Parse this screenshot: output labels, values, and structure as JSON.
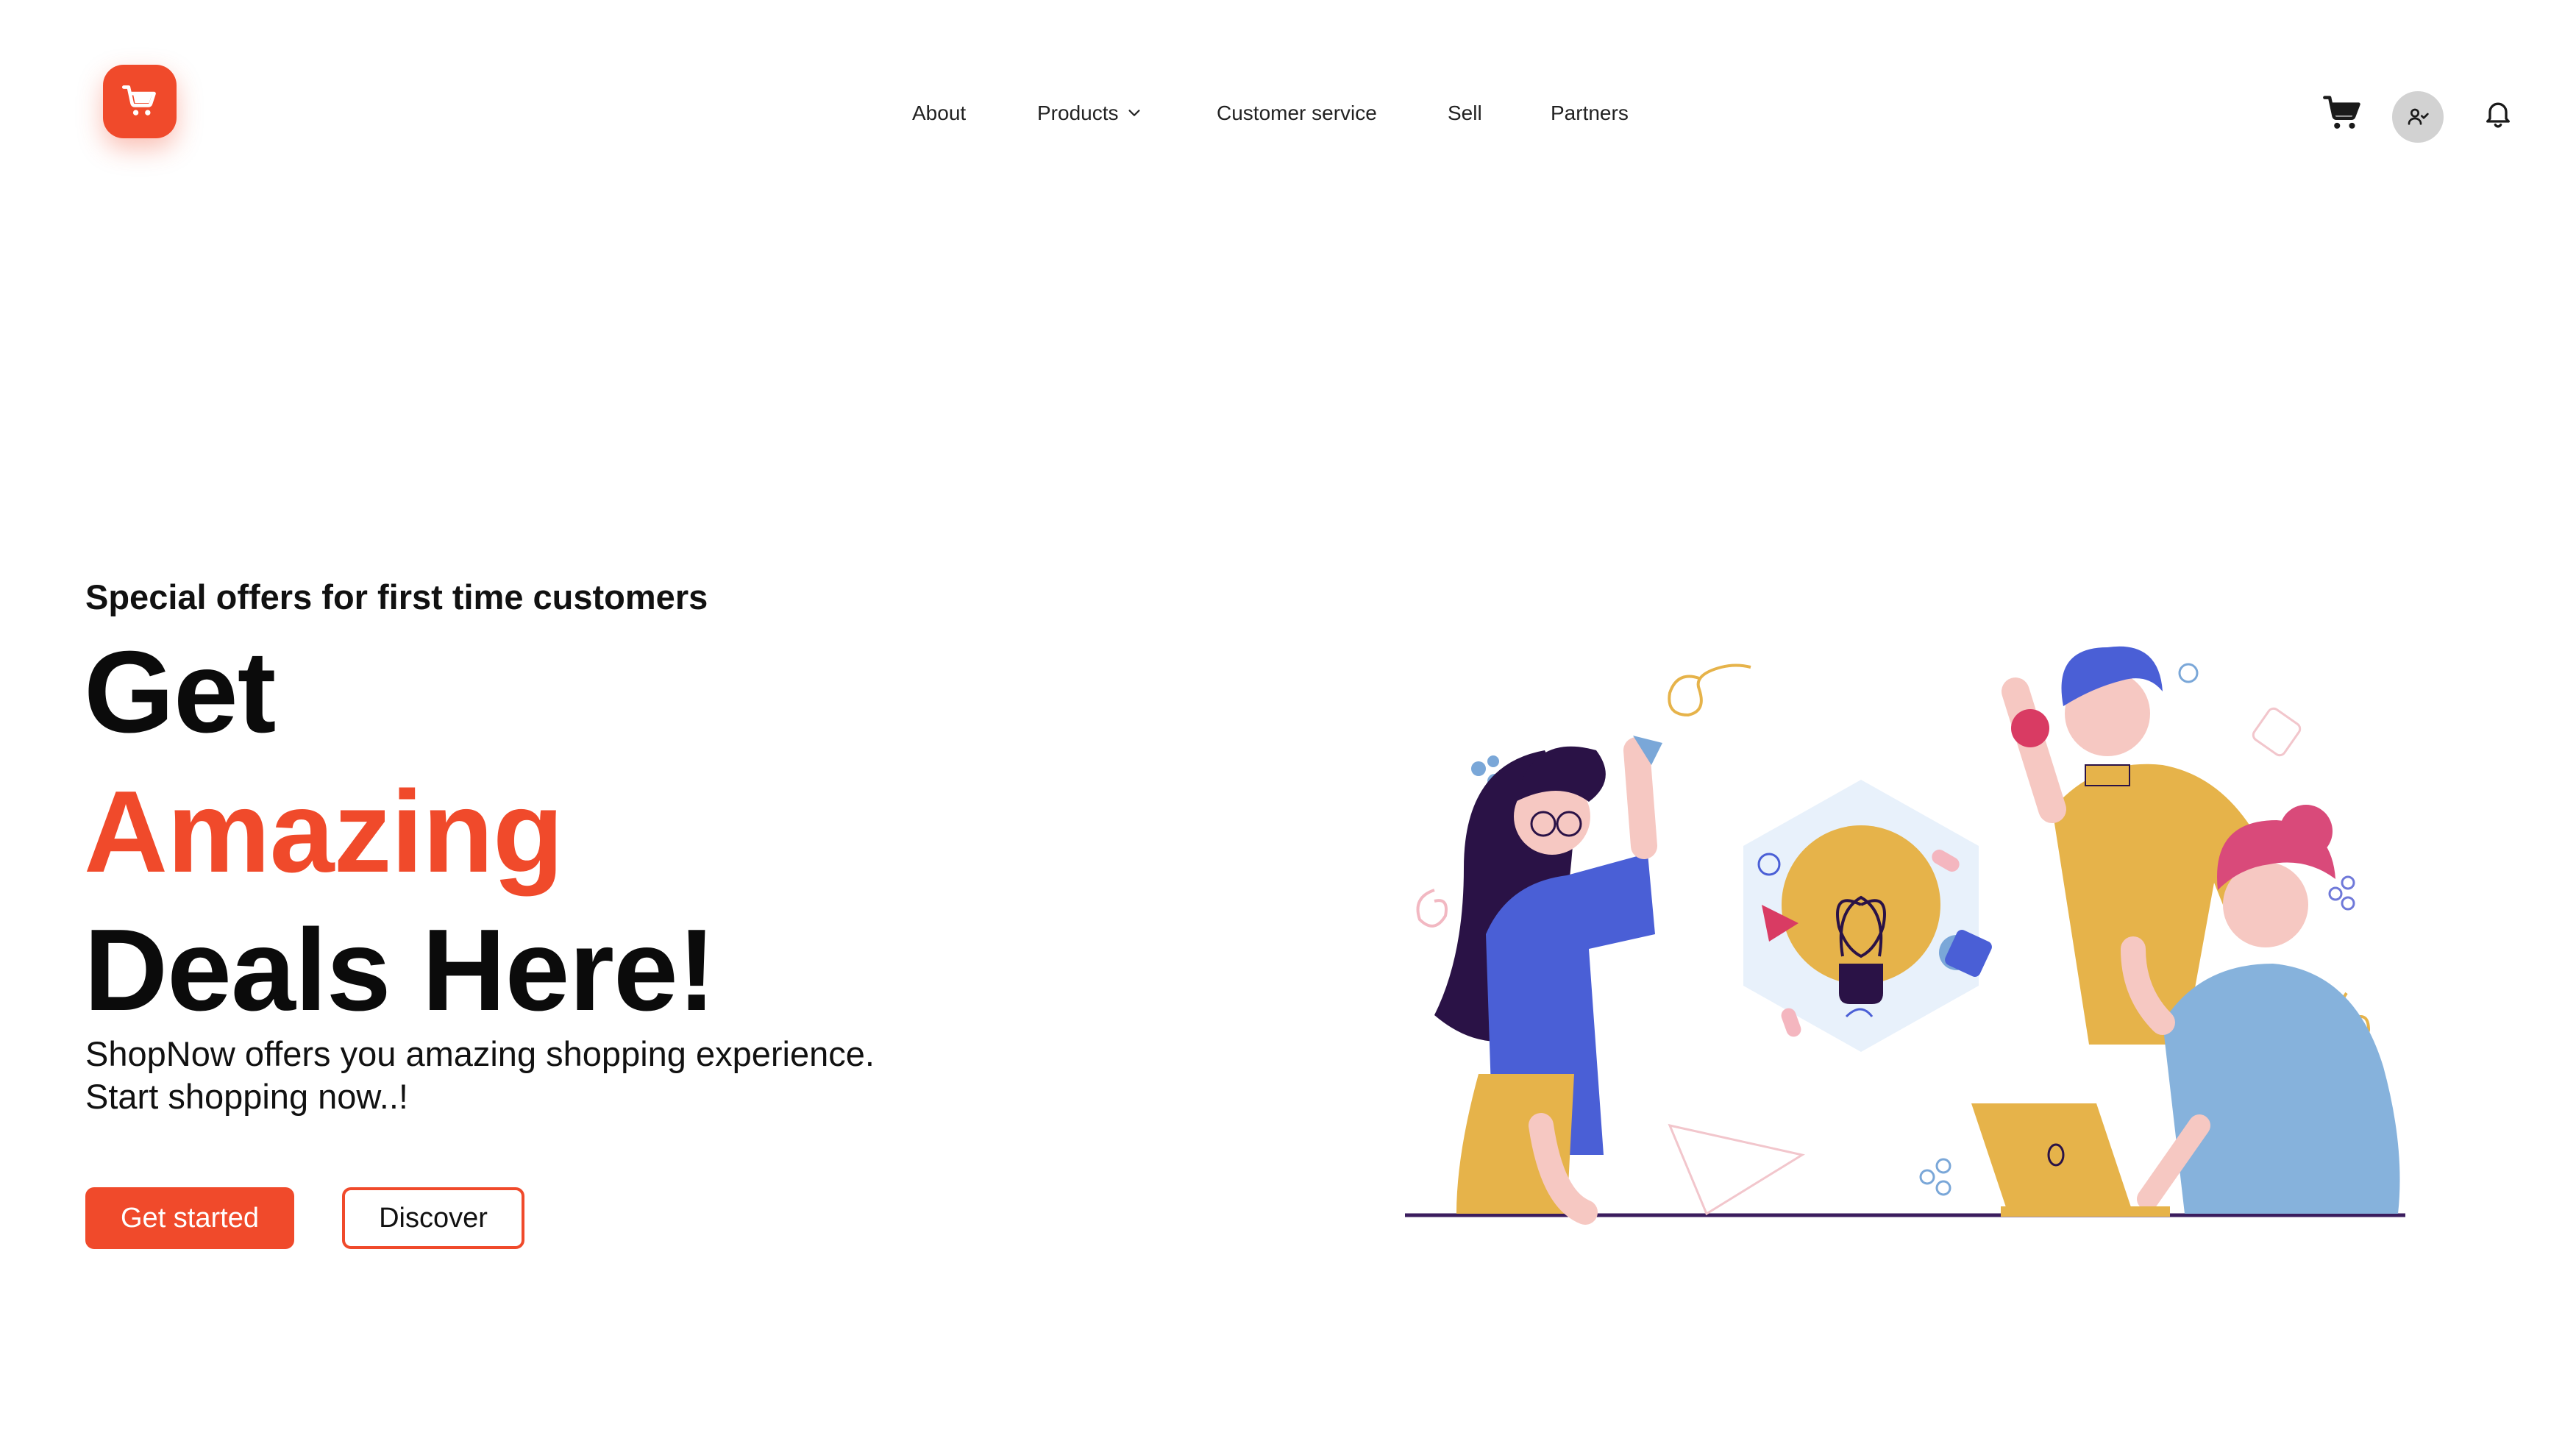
{
  "header": {
    "logo_icon": "shopping-cart-icon",
    "nav": [
      {
        "label": "About"
      },
      {
        "label": "Products",
        "icon": "chevron-down-icon"
      },
      {
        "label": "Customer service"
      },
      {
        "label": "Sell"
      },
      {
        "label": "Partners"
      }
    ],
    "actions": {
      "cart_icon": "shopping-cart-icon",
      "profile_icon": "user-check-icon",
      "notifications_icon": "bell-icon"
    }
  },
  "hero": {
    "eyebrow": "Special offers for first time customers",
    "headline_line1": "Get",
    "headline_line2": "Amazing",
    "headline_line3": "Deals Here!",
    "subtext_line1": "ShopNow offers you amazing shopping experience.",
    "subtext_line2": "Start shopping now..!",
    "primary_button": "Get started",
    "secondary_button": "Discover",
    "illustration": "team-brainstorming-lightbulb-illustration"
  },
  "colors": {
    "accent": "#f04a2b",
    "text": "#111111",
    "background": "#ffffff"
  }
}
